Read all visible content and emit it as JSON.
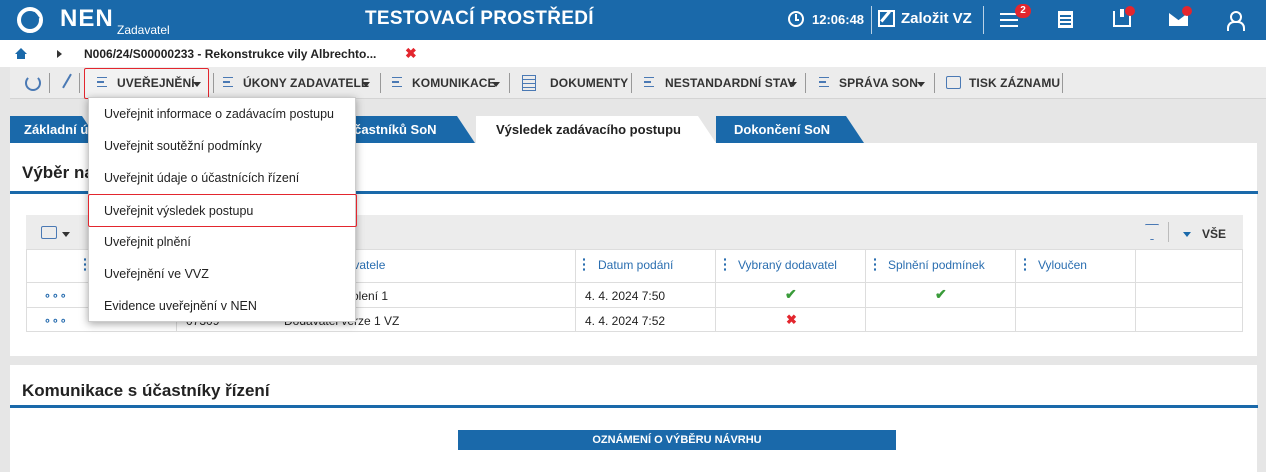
{
  "header": {
    "logo": "NEN",
    "logo_sub": "Zadavatel",
    "env_title": "TESTOVACÍ PROSTŘEDÍ",
    "time": "12:06:48",
    "create_label": "Založit VZ",
    "notification_count": "2"
  },
  "breadcrumb": {
    "text": "N006/24/S00000233 - Rekonstrukce vily Albrechto...",
    "close": "✖"
  },
  "toolbar": {
    "publish": "UVEŘEJNĚNÍ",
    "authority_acts": "ÚKONY ZADAVATELE",
    "communication": "KOMUNIKACE",
    "documents": "DOKUMENTY",
    "non_standard": "NESTANDARDNÍ STAV",
    "son_admin": "SPRÁVA SON",
    "print_record": "TISK ZÁZNAMU"
  },
  "tabs": [
    {
      "label": "Základní ú"
    },
    {
      "label": "í účastníků SoN"
    },
    {
      "label": "Výsledek zadávacího postupu"
    },
    {
      "label": "Dokončení SoN"
    }
  ],
  "panel1": {
    "title": "Výběr na"
  },
  "grid": {
    "all_label": "VŠE",
    "columns": [
      "",
      "davatele",
      "Datum podání",
      "Vybraný dodavatel",
      "Splnění podmínek",
      "Vyloučen"
    ],
    "rows": [
      {
        "menu": "∘∘∘",
        "id": "",
        "supplier": "školení 1",
        "date": "4. 4. 2024 7:50",
        "selected": "✔",
        "conditions": "✔",
        "excluded": ""
      },
      {
        "menu": "∘∘∘",
        "id": "07309",
        "supplier": "Dodavatel verze 1 VZ",
        "date": "4. 4. 2024 7:52",
        "selected": "✖",
        "conditions": "",
        "excluded": ""
      }
    ]
  },
  "panel2": {
    "title": "Komunikace s účastníky řízení",
    "notice_button": "OZNÁMENÍ O VÝBĚRU NÁVRHU"
  },
  "dropdown": {
    "items": [
      {
        "label": "Uveřejnit informace o zadávacím postupu"
      },
      {
        "label": "Uveřejnit soutěžní podmínky"
      },
      {
        "label": "Uveřejnit údaje o účastnících řízení"
      },
      {
        "label": "Uveřejnit výsledek postupu"
      },
      {
        "label": "Uveřejnit plnění"
      },
      {
        "label": "Uveřejnění ve VVZ"
      },
      {
        "label": "Evidence uveřejnění v NEN"
      }
    ]
  },
  "colors": {
    "brand_blue": "#1a69aa",
    "highlight_red": "#e3262e",
    "check_green": "#3a9b3a"
  }
}
